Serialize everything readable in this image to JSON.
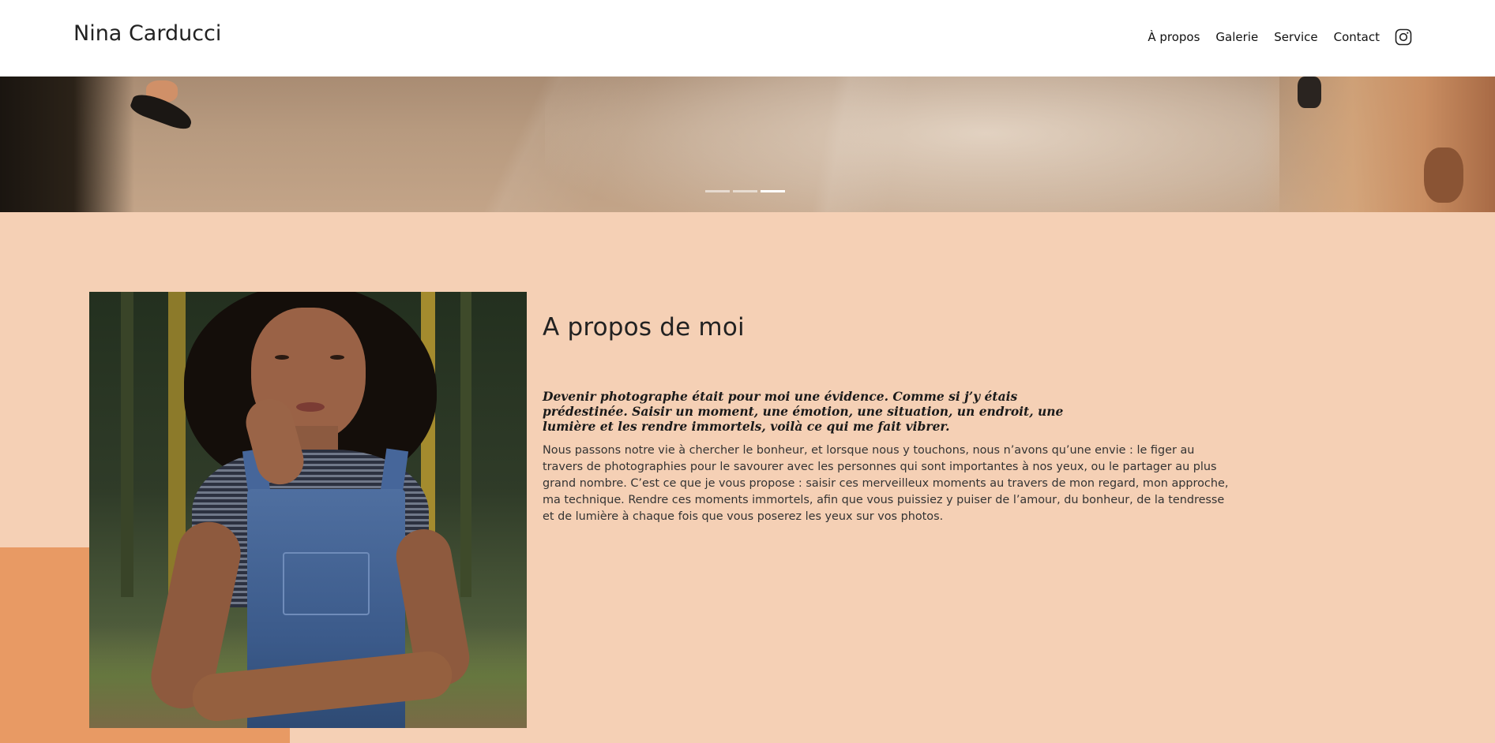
{
  "header": {
    "brand": "Nina Carducci",
    "nav": [
      {
        "label": "À propos"
      },
      {
        "label": "Galerie"
      },
      {
        "label": "Service"
      },
      {
        "label": "Contact"
      }
    ],
    "social_icon": "instagram-icon"
  },
  "carousel": {
    "slide_count": 3,
    "active_index": 2
  },
  "about": {
    "title": "A propos de moi",
    "quote": "Devenir photographe était pour moi une évidence. Comme si j’y étais prédestinée. Saisir un moment, une émotion, une situation, un endroit, une lumière et les rendre immortels, voilà ce qui me fait vibrer.",
    "body": "Nous passons notre vie à chercher le bonheur, et lorsque nous y touchons, nous n’avons qu’une envie : le figer au travers de photographies pour le savourer avec les personnes qui sont importantes à nos yeux, ou le partager au plus grand nombre. C’est ce que je vous propose : saisir ces merveilleux moments au travers de mon regard, mon approche, ma technique. Rendre ces moments immortels, afin que vous puissiez y puiser de l’amour, du bonheur, de la tendresse et de lumière à chaque fois que vous poserez les yeux sur vos photos."
  },
  "colors": {
    "page_background": "#f5d0b5",
    "accent_block": "#e89a64",
    "header_background": "#ffffff"
  }
}
